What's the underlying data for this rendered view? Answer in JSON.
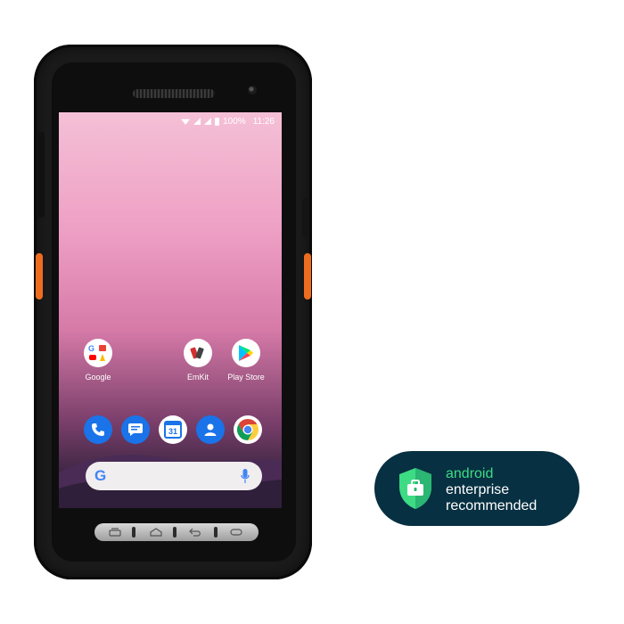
{
  "status_bar": {
    "battery": "100%",
    "time": "11:26"
  },
  "apps": [
    {
      "label": "Google",
      "icon": "google-folder-icon"
    },
    {
      "label": "EmKit",
      "icon": "emkit-icon"
    },
    {
      "label": "Play Store",
      "icon": "play-store-icon"
    }
  ],
  "dock": [
    "phone-icon",
    "messages-icon",
    "calendar-icon",
    "contacts-icon",
    "chrome-icon"
  ],
  "calendar_day": "31",
  "search": {
    "logo": "G"
  },
  "badge": {
    "line1": "android",
    "line2": "enterprise",
    "line3": "recommended",
    "accent": "#3ddc84",
    "background": "#073042"
  },
  "colors": {
    "scan_button": "#ee6c1f"
  }
}
